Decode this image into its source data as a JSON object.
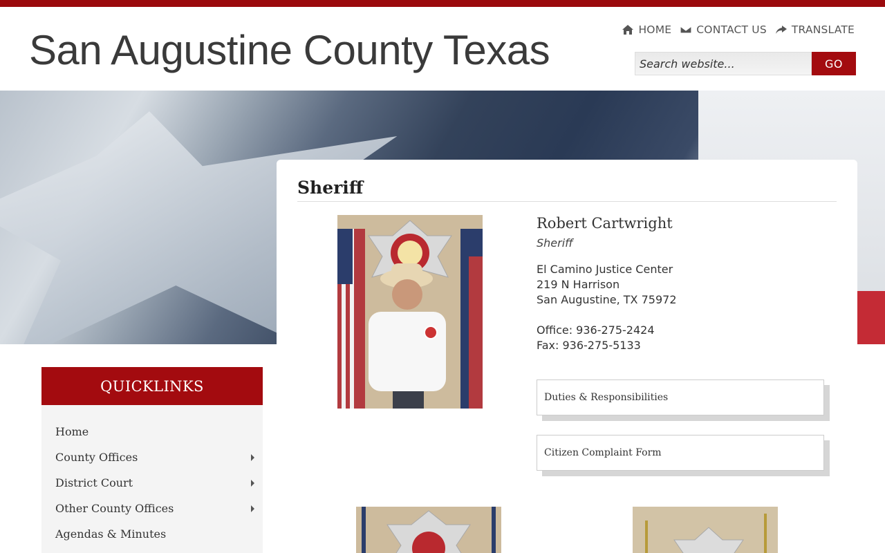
{
  "site": {
    "title": "San Augustine County Texas"
  },
  "top_nav": [
    {
      "label": "HOME",
      "icon": "home-icon"
    },
    {
      "label": "CONTACT US",
      "icon": "envelope-icon"
    },
    {
      "label": "TRANSLATE",
      "icon": "share-icon"
    }
  ],
  "search": {
    "placeholder": "Search website...",
    "button_label": "GO"
  },
  "page": {
    "title": "Sheriff"
  },
  "person": {
    "name": "Robert Cartwright",
    "role": "Sheriff",
    "address_line1": "El Camino Justice Center",
    "address_line2": "219 N Harrison",
    "address_line3": "San Augustine, TX 75972",
    "office": "Office: 936-275-2424",
    "fax": "Fax: 936-275-5133"
  },
  "accordions": [
    {
      "label": "Duties & Responsibilities"
    },
    {
      "label": "Citizen Complaint Form"
    }
  ],
  "quicklinks": {
    "header": "QUICKLINKS",
    "items": [
      {
        "label": "Home",
        "has_submenu": false
      },
      {
        "label": "County Offices",
        "has_submenu": true
      },
      {
        "label": "District Court",
        "has_submenu": true
      },
      {
        "label": "Other County Offices",
        "has_submenu": true
      },
      {
        "label": "Agendas & Minutes",
        "has_submenu": false
      }
    ]
  },
  "colors": {
    "brand_red": "#a30b0f",
    "top_bar": "#9b0a0d"
  }
}
